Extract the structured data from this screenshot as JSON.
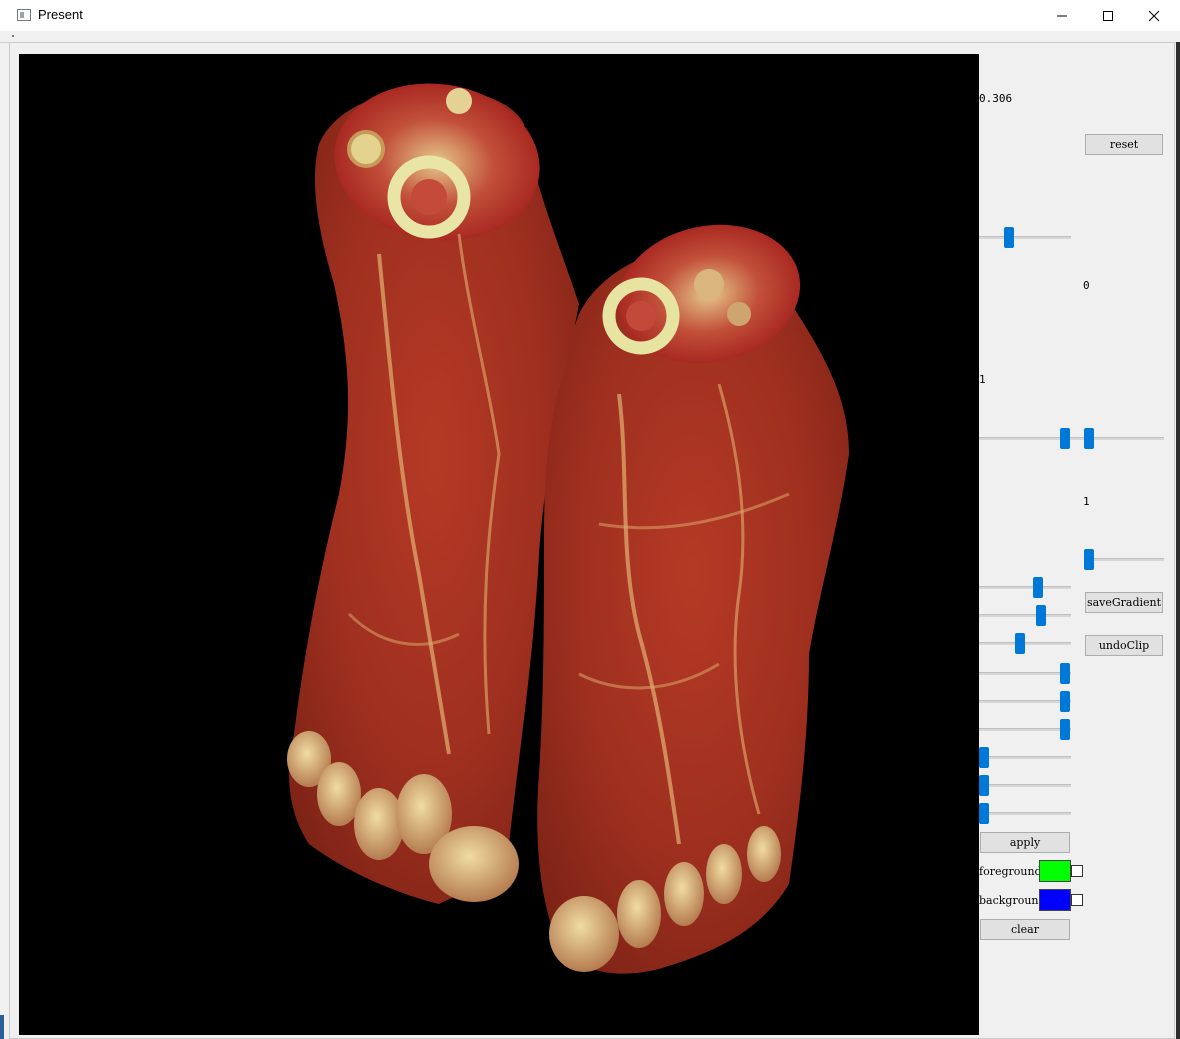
{
  "window": {
    "title": "Present"
  },
  "titlebar_buttons": [
    "minimize-icon",
    "maximize-icon",
    "close-icon"
  ],
  "colors": {
    "foreground_swatch": "#00ff00",
    "background_swatch": "#0000ff",
    "slider_handle": "#0078d7",
    "render_background": "#000000"
  },
  "viewport": {
    "content": "volume-rendering-feet"
  },
  "labels": {
    "value_top": "0.306",
    "value_zero": "0",
    "value_one_a": "1",
    "value_one_b": "1"
  },
  "buttons": {
    "reset": "reset",
    "save_gradient": "saveGradient",
    "undo_clip": "undoClip",
    "apply": "apply",
    "clear": "clear"
  },
  "color_pickers": {
    "foreground_label": "foreground",
    "background_label": "background"
  }
}
